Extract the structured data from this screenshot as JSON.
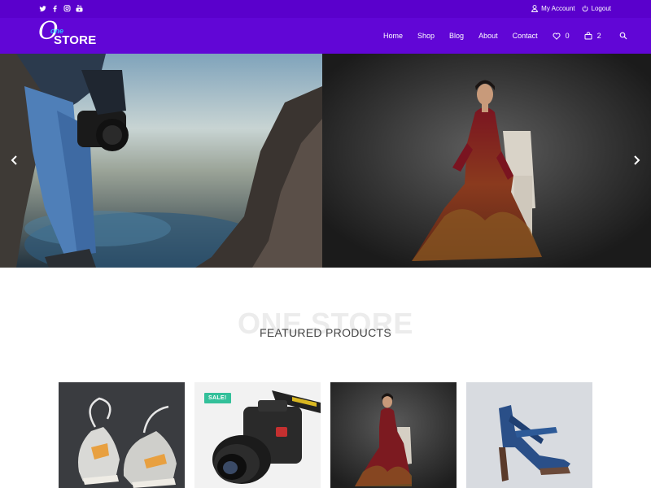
{
  "topbar": {
    "social_icons": [
      "twitter-icon",
      "facebook-icon",
      "instagram-icon",
      "youtube-icon"
    ],
    "my_account": "My Account",
    "logout": "Logout"
  },
  "header": {
    "logo": {
      "letter": "O",
      "small": "one",
      "word": "STORE"
    },
    "nav": {
      "home": "Home",
      "shop": "Shop",
      "blog": "Blog",
      "about": "About",
      "contact": "Contact",
      "wishlist_count": "0",
      "cart_count": "2"
    }
  },
  "slider": {
    "slides": [
      "photographer-with-camera-on-rocks",
      "woman-in-red-gown-seated"
    ]
  },
  "section": {
    "background_word": "ONE STORE",
    "title": "FEATURED PRODUCTS"
  },
  "products": [
    {
      "image": "sneakers",
      "badge": ""
    },
    {
      "image": "dslr-camera",
      "badge": "SALE!"
    },
    {
      "image": "woman-in-gown",
      "badge": ""
    },
    {
      "image": "blue-high-heel",
      "badge": ""
    }
  ],
  "colors": {
    "topbar": "#5a00cc",
    "header": "#6106d6",
    "accent_blue": "#29b6ff",
    "sale_badge": "#33c09a"
  }
}
